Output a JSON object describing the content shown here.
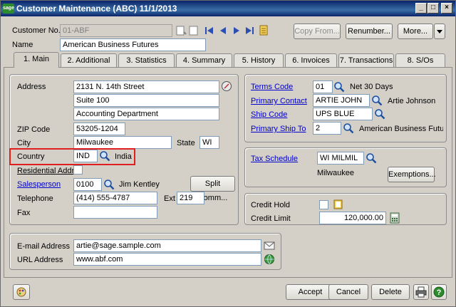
{
  "window": {
    "app_badge": "sage",
    "title": "Customer Maintenance (ABC) 11/1/2013",
    "min": "_",
    "max": "□",
    "close": "×"
  },
  "header": {
    "customer_no_label": "Customer No.",
    "customer_no": "01-ABF",
    "name_label": "Name",
    "name": "American Business Futures",
    "copy_from": "Copy From...",
    "renumber": "Renumber...",
    "more": "More..."
  },
  "tabs": [
    {
      "label": "1. Main"
    },
    {
      "label": "2. Additional"
    },
    {
      "label": "3. Statistics"
    },
    {
      "label": "4. Summary"
    },
    {
      "label": "5. History"
    },
    {
      "label": "6. Invoices"
    },
    {
      "label": "7. Transactions"
    },
    {
      "label": "8. S/Os"
    }
  ],
  "main": {
    "address_label": "Address",
    "address1": "2131 N. 14th Street",
    "address2": "Suite 100",
    "address3": "Accounting Department",
    "zip_label": "ZIP Code",
    "zip": "53205-1204",
    "city_label": "City",
    "city": "Milwaukee",
    "state_label": "State",
    "state": "WI",
    "country_label": "Country",
    "country": "IND",
    "country_name": "India",
    "residential_label": "Residential Addr",
    "salesperson_label": "Salesperson",
    "salesperson": "0100",
    "salesperson_name": "Jim Kentley",
    "split_comm": "Split Comm...",
    "telephone_label": "Telephone",
    "telephone": "(414) 555-4787",
    "ext_label": "Ext",
    "ext": "219",
    "fax_label": "Fax",
    "fax": ""
  },
  "terms": {
    "terms_code_label": "Terms Code",
    "terms_code": "01",
    "terms_desc": "Net 30 Days",
    "primary_contact_label": "Primary Contact",
    "primary_contact": "ARTIE JOHN",
    "primary_contact_name": "Artie Johnson",
    "ship_code_label": "Ship Code",
    "ship_code": "UPS BLUE",
    "primary_ship_to_label": "Primary Ship To",
    "primary_ship_to": "2",
    "primary_ship_to_name": "American Business Futur"
  },
  "tax": {
    "label": "Tax Schedule",
    "value": "WI MILMIL",
    "desc": "Milwaukee",
    "exemptions": "Exemptions..."
  },
  "credit": {
    "hold_label": "Credit Hold",
    "limit_label": "Credit Limit",
    "limit": "120,000.00"
  },
  "contact": {
    "email_label": "E-mail Address",
    "email": "artie@sage.sample.com",
    "url_label": "URL Address",
    "url": "www.abf.com"
  },
  "footer": {
    "accept": "Accept",
    "cancel": "Cancel",
    "delete": "Delete"
  },
  "colors": {
    "title_bar": "#0a246a",
    "link": "#0000cc",
    "highlight": "#e02020"
  }
}
